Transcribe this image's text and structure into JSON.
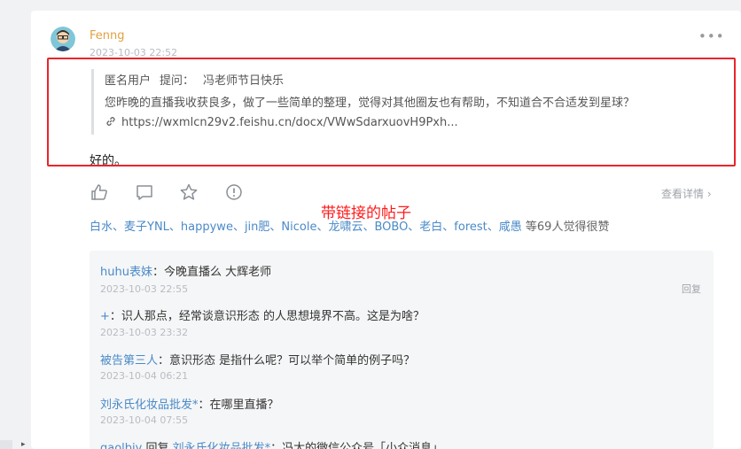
{
  "post": {
    "author": "Fenng",
    "time": "2023-10-03 22:52",
    "more_icon": "more-horizontal-icon",
    "quote": {
      "asker": "匿名用户",
      "ask_label": "提问：",
      "question_title": "冯老师节日快乐",
      "body": "您昨晚的直播我收获良多，做了一些简单的整理，觉得对其他圈友也有帮助，不知道合不合适发到星球？",
      "link_icon": "link-icon",
      "link": "https://wxmlcn29v2.feishu.cn/docx/VWwSdarxuovH9Pxh..."
    },
    "reply": "好的。",
    "actions": {
      "like_icon": "thumbs-up-icon",
      "comment_icon": "comment-icon",
      "star_icon": "star-icon",
      "report_icon": "alert-circle-icon",
      "view_detail": "查看详情 ›"
    },
    "annotation": "带链接的帖子",
    "likes": {
      "names": "白水、麦子YNL、happywe、jin肥、Nicole、龙啸云、BOBO、老白、forest、咸愚",
      "count_text": "等69人觉得很赞"
    }
  },
  "comments": [
    {
      "author": "huhu表妹",
      "separator": "：",
      "text": "今晚直播么 大辉老师",
      "time": "2023-10-03 22:55",
      "reply_label": "回复"
    },
    {
      "author": "+",
      "separator": "：",
      "text": "识人那点，经常谈意识形态 的人思想境界不高。这是为啥？",
      "time": "2023-10-03 23:32"
    },
    {
      "author": "被告第三人",
      "separator": "：",
      "text": "意识形态  是指什么呢？可以举个简单的例子吗？",
      "time": "2023-10-04 06:21"
    },
    {
      "author": "刘永氏化妆品批发*",
      "separator": "：",
      "text": "在哪里直播？",
      "time": "2023-10-04 07:55"
    },
    {
      "author": "gaolbiy",
      "reply_word": " 回复 ",
      "target": "刘永氏化妆品批发*",
      "separator": "：",
      "text": "冯大的微信公众号「小众消息」"
    }
  ],
  "colors": {
    "author": "#e3a042",
    "link_blue": "#4a8ac8",
    "annotation_red": "#ff1a1a",
    "frame_red": "#e8252a"
  }
}
